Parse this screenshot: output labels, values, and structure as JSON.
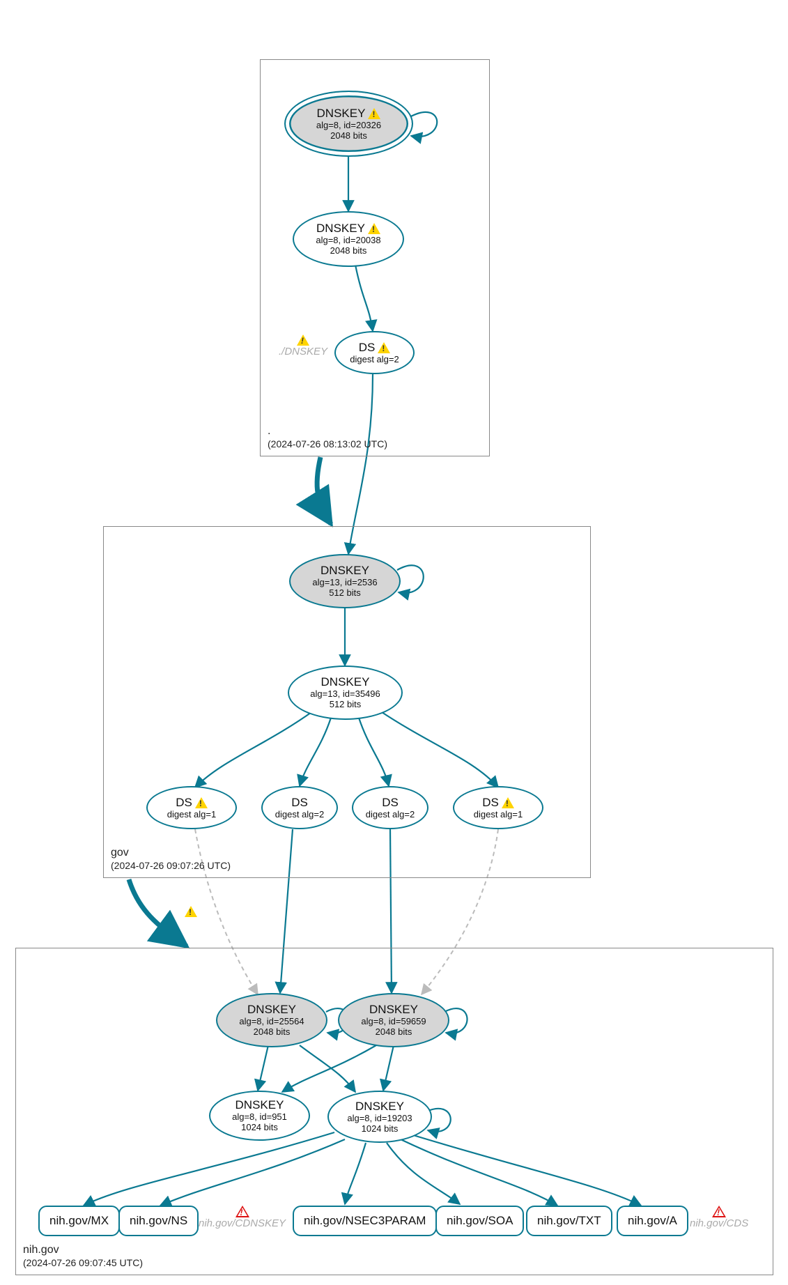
{
  "zones": {
    "root": {
      "name": ".",
      "timestamp": "(2024-07-26 08:13:02 UTC)",
      "ksk": {
        "title": "DNSKEY",
        "line1": "alg=8, id=20326",
        "line2": "2048 bits",
        "warn": true
      },
      "zsk": {
        "title": "DNSKEY",
        "line1": "alg=8, id=20038",
        "line2": "2048 bits",
        "warn": true
      },
      "ds": {
        "title": "DS",
        "line1": "digest alg=2",
        "warn": true
      },
      "ghost_dnskey": "./DNSKEY"
    },
    "gov": {
      "name": "gov",
      "timestamp": "(2024-07-26 09:07:26 UTC)",
      "ksk": {
        "title": "DNSKEY",
        "line1": "alg=13, id=2536",
        "line2": "512 bits"
      },
      "zsk": {
        "title": "DNSKEY",
        "line1": "alg=13, id=35496",
        "line2": "512 bits"
      },
      "ds1": {
        "title": "DS",
        "line1": "digest alg=1",
        "warn": true
      },
      "ds2": {
        "title": "DS",
        "line1": "digest alg=2"
      },
      "ds3": {
        "title": "DS",
        "line1": "digest alg=2"
      },
      "ds4": {
        "title": "DS",
        "line1": "digest alg=1",
        "warn": true
      }
    },
    "nih": {
      "name": "nih.gov",
      "timestamp": "(2024-07-26 09:07:45 UTC)",
      "ksk1": {
        "title": "DNSKEY",
        "line1": "alg=8, id=25564",
        "line2": "2048 bits"
      },
      "ksk2": {
        "title": "DNSKEY",
        "line1": "alg=8, id=59659",
        "line2": "2048 bits"
      },
      "zsk1": {
        "title": "DNSKEY",
        "line1": "alg=8, id=951",
        "line2": "1024 bits"
      },
      "zsk2": {
        "title": "DNSKEY",
        "line1": "alg=8, id=19203",
        "line2": "1024 bits"
      },
      "ghost_cdnskey": "nih.gov/CDNSKEY",
      "ghost_cds": "nih.gov/CDS",
      "rrsets": {
        "mx": "nih.gov/MX",
        "ns": "nih.gov/NS",
        "n3p": "nih.gov/NSEC3PARAM",
        "soa": "nih.gov/SOA",
        "txt": "nih.gov/TXT",
        "a": "nih.gov/A"
      }
    }
  }
}
